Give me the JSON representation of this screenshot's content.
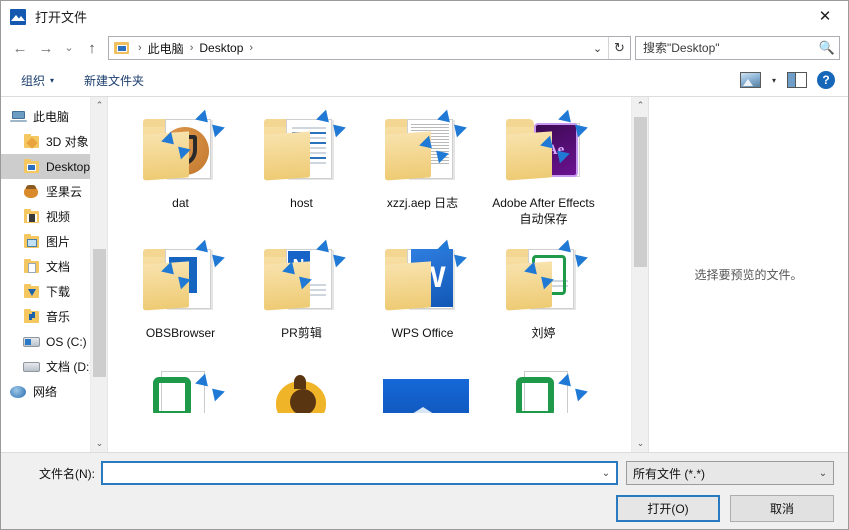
{
  "window": {
    "title": "打开文件",
    "app_icon": "image-app-icon",
    "close_label": "✕"
  },
  "nav": {
    "back_icon": "arrow-left-icon",
    "forward_icon": "arrow-right-icon",
    "recent_icon": "chevron-down-icon",
    "up_icon": "arrow-up-icon",
    "breadcrumb_icon": "desktop-folder-icon",
    "crumbs": [
      "此电脑",
      "Desktop"
    ],
    "separator": "›",
    "address_chevron": "chevron-down-icon",
    "refresh_icon": "refresh-icon"
  },
  "search": {
    "placeholder": "搜索\"Desktop\"",
    "value": "",
    "icon": "search-icon"
  },
  "commandbar": {
    "organize": "组织",
    "organize_caret": "▾",
    "new_folder": "新建文件夹",
    "view_icon": "view-thumbnail-icon",
    "view_caret": "▾",
    "preview_pane_icon": "preview-pane-icon",
    "help_icon": "?"
  },
  "sidebar": {
    "items": [
      {
        "label": "此电脑",
        "icon": "this-pc-icon",
        "indent": 1,
        "selected": false
      },
      {
        "label": "3D 对象",
        "icon": "folder-3d-objects-icon",
        "indent": 2,
        "selected": false
      },
      {
        "label": "Desktop",
        "icon": "folder-desktop-icon",
        "indent": 2,
        "selected": true
      },
      {
        "label": "坚果云",
        "icon": "nutstore-icon",
        "indent": 2,
        "selected": false
      },
      {
        "label": "视频",
        "icon": "folder-videos-icon",
        "indent": 2,
        "selected": false
      },
      {
        "label": "图片",
        "icon": "folder-pictures-icon",
        "indent": 2,
        "selected": false
      },
      {
        "label": "文档",
        "icon": "folder-documents-icon",
        "indent": 2,
        "selected": false
      },
      {
        "label": "下载",
        "icon": "folder-downloads-icon",
        "indent": 2,
        "selected": false
      },
      {
        "label": "音乐",
        "icon": "folder-music-icon",
        "indent": 2,
        "selected": false
      },
      {
        "label": "OS (C:)",
        "icon": "drive-os-icon",
        "indent": 2,
        "selected": false
      },
      {
        "label": "文档 (D:)",
        "icon": "drive-documents-icon",
        "indent": 2,
        "selected": false
      },
      {
        "label": "网络",
        "icon": "network-icon",
        "indent": 1,
        "selected": false
      }
    ],
    "scroll_up_icon": "chevron-up-icon",
    "scroll_down_icon": "chevron-down-icon"
  },
  "files": {
    "items": [
      {
        "name": "dat",
        "kind": "folder-dat"
      },
      {
        "name": "host",
        "kind": "folder-host"
      },
      {
        "name": "xzzj.aep 日志",
        "kind": "folder-text"
      },
      {
        "name": "Adobe After Effects 自动保存",
        "kind": "folder-ae"
      },
      {
        "name": "OBSBrowser",
        "kind": "folder-obs"
      },
      {
        "name": "PR剪辑",
        "kind": "folder-pr"
      },
      {
        "name": "WPS Office",
        "kind": "folder-wps"
      },
      {
        "name": "刘婷",
        "kind": "folder-green"
      }
    ],
    "partial_row": [
      {
        "name": "",
        "kind": "green-icon"
      },
      {
        "name": "",
        "kind": "cat-icon"
      },
      {
        "name": "",
        "kind": "blue-icon"
      },
      {
        "name": "",
        "kind": "green-icon"
      }
    ],
    "scroll_up_icon": "chevron-up-icon",
    "scroll_down_icon": "chevron-down-icon"
  },
  "preview": {
    "message": "选择要预览的文件。"
  },
  "footer": {
    "filename_label": "文件名(N):",
    "filename_value": "",
    "filename_caret": "⌄",
    "filter_value": "所有文件 (*.*)",
    "filter_caret": "⌄",
    "open_button": "打开(O)",
    "cancel_button": "取消"
  },
  "colors": {
    "accent": "#2a7ac0",
    "selection": "#cdcdcd",
    "folder": "#f0cf7e",
    "overlay_arrow": "#2079d4",
    "footer_bg": "#f0f0f0"
  }
}
